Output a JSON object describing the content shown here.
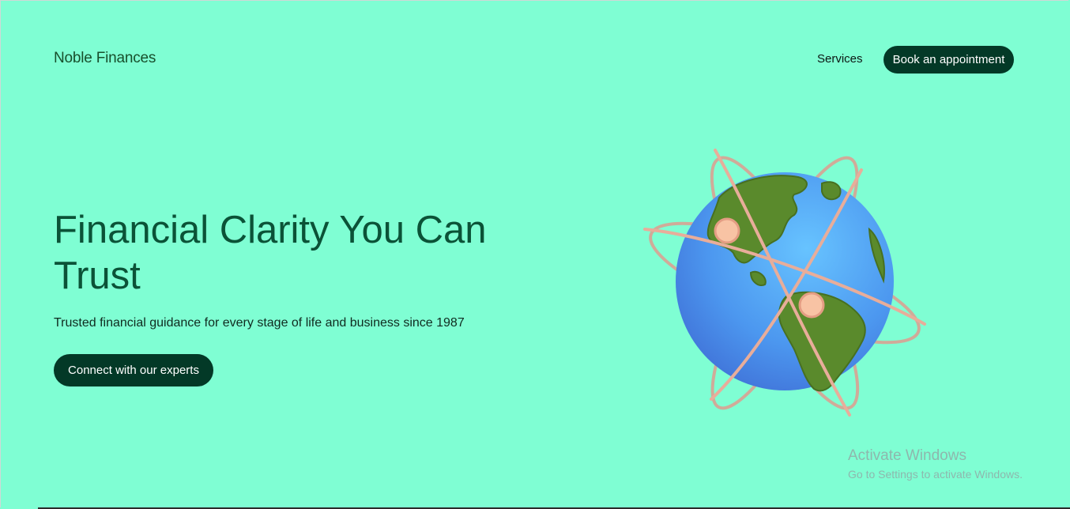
{
  "brand": {
    "name": "Noble Finances"
  },
  "nav": {
    "services_label": "Services",
    "book_label": "Book an appointment"
  },
  "hero": {
    "title": "Financial Clarity You Can Trust",
    "subtitle": "Trusted financial guidance for every stage of life and business since 1987",
    "cta_label": "Connect with our experts"
  },
  "illustration": {
    "icon": "globe-with-orbits-illustration"
  },
  "os_overlay": {
    "title": "Activate Windows",
    "subtitle": "Go to Settings to activate Windows."
  },
  "colors": {
    "background": "#7ffed3",
    "accent_dark": "#033927",
    "headline": "#0b5237",
    "brand_text": "#184f2c"
  }
}
